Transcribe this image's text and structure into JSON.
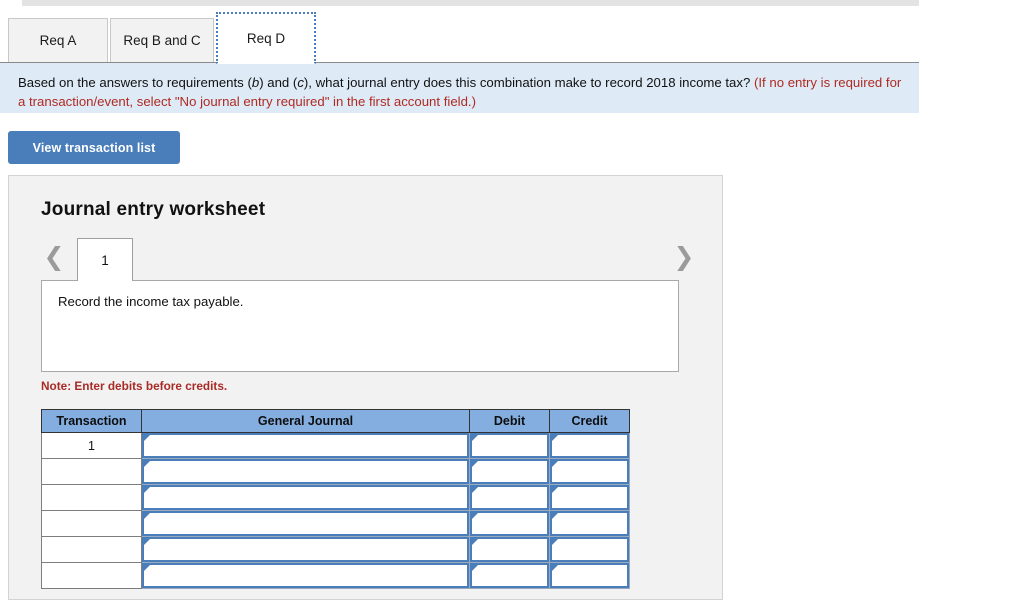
{
  "tabs": [
    {
      "label": "Req A",
      "active": false
    },
    {
      "label": "Req B and C",
      "active": false
    },
    {
      "label": "Req D",
      "active": true
    }
  ],
  "banner": {
    "line1_a": "Based on the answers to requirements (",
    "em1": "b",
    "line1_b": ") and (",
    "em2": "c",
    "line1_c": "), what journal entry does this combination make to record 2018 income tax? ",
    "red": "(If no entry is required for a transaction/event, select \"No journal entry required\" in the first account field.)"
  },
  "toolbar": {
    "view_transaction_list_label": "View transaction list"
  },
  "worksheet": {
    "title": "Journal entry worksheet",
    "pager": {
      "prev_icon": "chevron-left-icon",
      "next_icon": "chevron-right-icon",
      "current_page": "1"
    },
    "description": "Record the income tax payable.",
    "note": "Note: Enter debits before credits.",
    "table": {
      "headers": [
        "Transaction",
        "General Journal",
        "Debit",
        "Credit"
      ],
      "rows": [
        {
          "transaction": "1",
          "general_journal": "",
          "debit": "",
          "credit": ""
        },
        {
          "transaction": "",
          "general_journal": "",
          "debit": "",
          "credit": ""
        },
        {
          "transaction": "",
          "general_journal": "",
          "debit": "",
          "credit": ""
        },
        {
          "transaction": "",
          "general_journal": "",
          "debit": "",
          "credit": ""
        },
        {
          "transaction": "",
          "general_journal": "",
          "debit": "",
          "credit": ""
        },
        {
          "transaction": "",
          "general_journal": "",
          "debit": "",
          "credit": ""
        }
      ]
    }
  },
  "colors": {
    "accent_blue": "#4a7ebb",
    "header_blue": "#84aee0",
    "banner_blue": "#deebf7",
    "note_red": "#a82b26",
    "panel_gray": "#f2f2f2"
  }
}
